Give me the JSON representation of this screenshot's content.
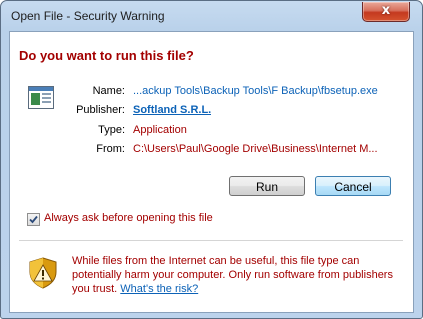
{
  "window": {
    "title": "Open File - Security Warning",
    "close_glyph": "x"
  },
  "dialog": {
    "question": "Do you want to run this file?",
    "fields": {
      "name_label": "Name:",
      "name_value": "...ackup Tools\\Backup Tools\\F Backup\\fbsetup.exe",
      "publisher_label": "Publisher:",
      "publisher_value": "Softland S.R.L.",
      "type_label": "Type:",
      "type_value": "Application",
      "from_label": "From:",
      "from_value": "C:\\Users\\Paul\\Google Drive\\Business\\Internet M..."
    },
    "buttons": {
      "run": "Run",
      "cancel": "Cancel"
    },
    "checkbox": {
      "label": "Always ask before opening this file",
      "checked": true
    },
    "warning": {
      "text": "While files from the Internet can be useful, this file type can potentially harm your computer. Only run software from publishers you trust. ",
      "link": "What's the risk?"
    }
  },
  "icons": {
    "file": "application-file-icon",
    "shield": "security-shield-icon",
    "checkmark": "checkmark-icon"
  },
  "colors": {
    "warning_red": "#a30000",
    "link_blue": "#0c62b7",
    "frame_blue": "#b9d1ea"
  }
}
